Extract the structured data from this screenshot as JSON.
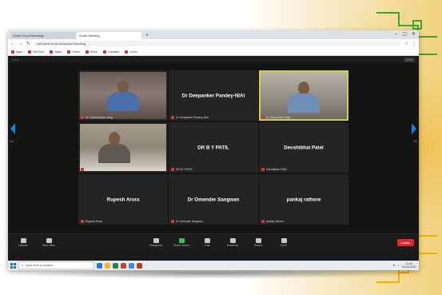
{
  "browser": {
    "tabs": [
      "Zoom Cloud Meetings",
      "Zoom Meeting"
    ],
    "url": "us02web.zoom.us/wc/join/meeting",
    "bookmarks": [
      "Apps",
      "YouTube",
      "Maps",
      "Gmail",
      "News",
      "Translate",
      "Zoom"
    ]
  },
  "zoom": {
    "top_left": "View",
    "top_right": "Grid",
    "page_left": "1/2",
    "page_right": "1/2"
  },
  "participants": [
    {
      "name": "",
      "caption": "Dr. Sureshkumar Garg",
      "video": "v1"
    },
    {
      "name": "Dr Deepanker Pandey-NIAI",
      "caption": "Dr Deepanker Pandey-NIAI",
      "video": ""
    },
    {
      "name": "",
      "caption": "Dr. Bhupinder Singh",
      "video": "v2",
      "highlight": true
    },
    {
      "name": "",
      "caption": "Santosh Shinde",
      "video": "v3"
    },
    {
      "name": "DR B Y PATIL",
      "caption": "DR B Y PATIL",
      "video": ""
    },
    {
      "name": "Devshibhai Patel",
      "caption": "Devshibhai Patel",
      "video": ""
    },
    {
      "name": "Rupesh Arora",
      "caption": "Rupesh Arora",
      "video": ""
    },
    {
      "name": "Dr Omender Sangwan",
      "caption": "Dr Omender Sangwan",
      "video": ""
    },
    {
      "name": "pankaj rathore",
      "caption": "pankaj rathore",
      "video": ""
    }
  ],
  "toolbar": {
    "left": [
      "Unmute",
      "Start Video"
    ],
    "middle": [
      "Participants",
      "Share Screen",
      "Chat",
      "Reactions",
      "Record",
      "More"
    ],
    "leave": "Leave"
  },
  "taskbar": {
    "search_placeholder": "Type here to search",
    "time": "11:45",
    "date": "19-03-2021"
  },
  "colors": {
    "highlight": "#c9d24a",
    "leave": "#e02828",
    "arrow": "#1a7fe0",
    "deco_green": "#3ea532",
    "deco_gold": "#e7b300"
  }
}
